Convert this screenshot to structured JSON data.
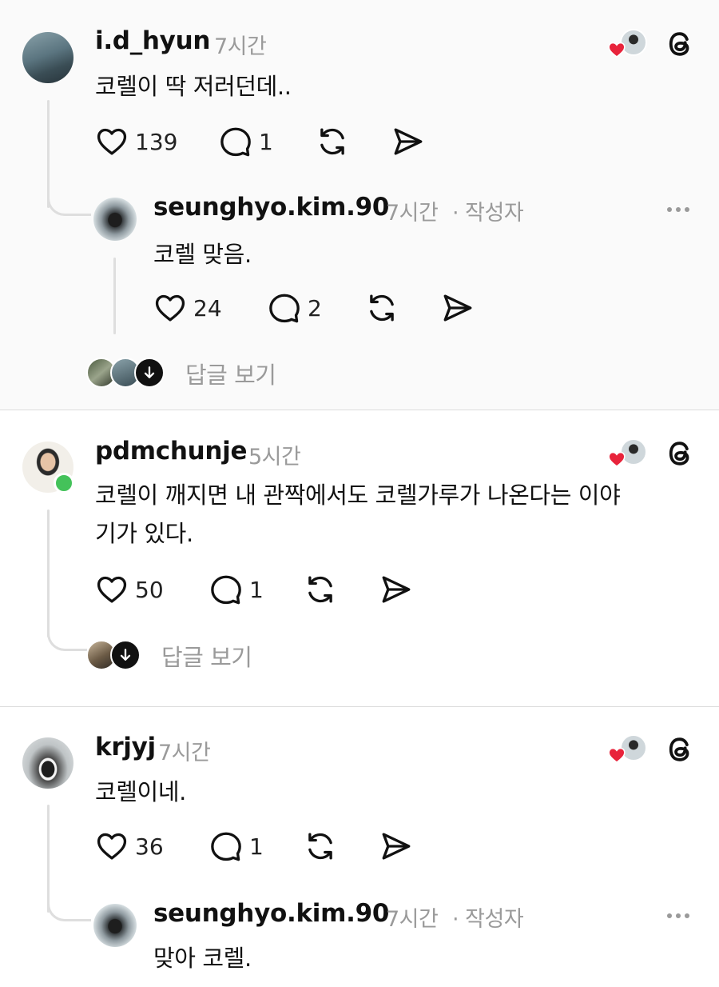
{
  "comments": [
    {
      "username": "i.d_hyun",
      "time": "7시간",
      "text": "코렐이 딱 저러던데..",
      "likes": "139",
      "replies": "1",
      "reply": {
        "username": "seunghyo.kim.90",
        "time": "7시간",
        "author_tag": "· 작성자",
        "text": "코렐 맞음.",
        "likes": "24",
        "replies": "2"
      },
      "view_replies": "답글 보기"
    },
    {
      "username": "pdmchunje",
      "time": "5시간",
      "text_line1": "코렐이 깨지면 내 관짝에서도 코렐가루가 나온다는 이야",
      "text_line2": "기가 있다.",
      "likes": "50",
      "replies": "1",
      "view_replies": "답글 보기"
    },
    {
      "username": "krjyj",
      "time": "7시간",
      "text": "코렐이네.",
      "likes": "36",
      "replies": "1",
      "reply": {
        "username": "seunghyo.kim.90",
        "time": "7시간",
        "author_tag": "· 작성자",
        "text": "맞아 코렐."
      }
    }
  ],
  "icons": {
    "like": "heart-icon",
    "reply": "speech-bubble-icon",
    "repost": "repost-icon",
    "share": "send-icon",
    "brand": "threads-logo-icon",
    "more": "more-dots-icon",
    "down": "arrow-down-icon"
  },
  "colors": {
    "heart_badge": "#e8233b",
    "online": "#44c25a",
    "muted": "#9a9a9a"
  }
}
